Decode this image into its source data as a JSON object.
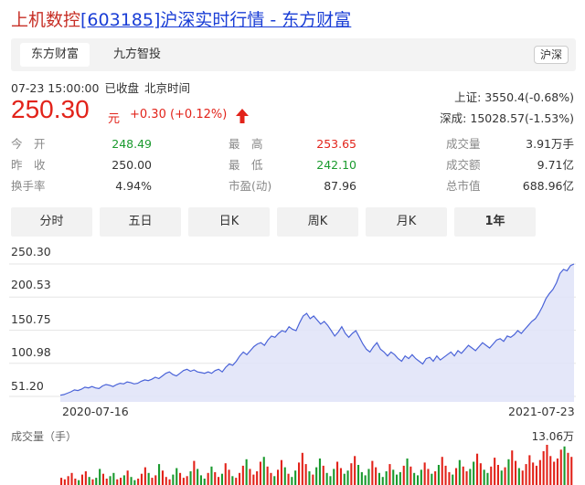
{
  "header": {
    "name": "上机数控",
    "code": "[603185]",
    "suffix": "沪深实时行情 - 东方财富"
  },
  "tabs": [
    {
      "label": "东方财富",
      "active": true
    },
    {
      "label": "九方智投",
      "active": false
    }
  ],
  "market_pill": "沪深",
  "status": {
    "datetime": "07-23 15:00:00",
    "state": "已收盘",
    "timezone": "北京时间"
  },
  "quote": {
    "price": "250.30",
    "unit": "元",
    "change": "+0.30 (+0.12%)",
    "direction": "up"
  },
  "indices": [
    {
      "label": "上证:",
      "value": "3550.4(-0.68%)"
    },
    {
      "label": "深成:",
      "value": "15028.57(-1.53%)"
    }
  ],
  "stats": [
    [
      {
        "label": "今　开",
        "value": "248.49",
        "color": "green"
      },
      {
        "label": "最　高",
        "value": "253.65",
        "color": "red"
      },
      {
        "label": "成交量",
        "value": "3.91万手",
        "color": ""
      }
    ],
    [
      {
        "label": "昨　收",
        "value": "250.00",
        "color": ""
      },
      {
        "label": "最　低",
        "value": "242.10",
        "color": "green"
      },
      {
        "label": "成交额",
        "value": "9.71亿",
        "color": ""
      }
    ],
    [
      {
        "label": "换手率",
        "value": "4.94%",
        "color": ""
      },
      {
        "label": "市盈(动)",
        "value": "87.96",
        "color": ""
      },
      {
        "label": "总市值",
        "value": "688.96亿",
        "color": ""
      }
    ]
  ],
  "period_tabs": [
    {
      "label": "分时",
      "active": false
    },
    {
      "label": "五日",
      "active": false
    },
    {
      "label": "日K",
      "active": false
    },
    {
      "label": "周K",
      "active": false
    },
    {
      "label": "月K",
      "active": false
    },
    {
      "label": "1年",
      "active": true
    }
  ],
  "volume": {
    "label": "成交量（手）",
    "max_label": "13.06万"
  },
  "chart_data": {
    "type": "area",
    "y_ticks": [
      "250.30",
      "200.53",
      "150.75",
      "100.98",
      "51.20"
    ],
    "ylim": [
      51.2,
      250.3
    ],
    "x_labels": [
      "2020-07-16",
      "2021-07-23"
    ],
    "values": [
      53,
      54,
      56,
      58,
      61,
      60,
      62,
      65,
      64,
      66,
      64,
      63,
      67,
      69,
      68,
      66,
      69,
      71,
      70,
      73,
      72,
      70,
      71,
      74,
      76,
      75,
      77,
      80,
      78,
      82,
      86,
      88,
      84,
      82,
      86,
      90,
      92,
      89,
      91,
      88,
      87,
      86,
      88,
      86,
      90,
      92,
      88,
      95,
      100,
      98,
      104,
      112,
      118,
      114,
      120,
      126,
      130,
      132,
      128,
      136,
      142,
      140,
      146,
      150,
      148,
      156,
      152,
      150,
      162,
      172,
      176,
      168,
      172,
      166,
      160,
      164,
      158,
      150,
      142,
      148,
      156,
      146,
      140,
      146,
      150,
      140,
      130,
      122,
      118,
      126,
      132,
      122,
      118,
      112,
      118,
      114,
      108,
      104,
      112,
      108,
      114,
      108,
      104,
      100,
      108,
      110,
      104,
      112,
      106,
      110,
      114,
      118,
      112,
      120,
      116,
      122,
      128,
      124,
      120,
      126,
      132,
      128,
      124,
      130,
      136,
      138,
      134,
      142,
      140,
      144,
      150,
      146,
      152,
      158,
      164,
      168,
      176,
      186,
      198,
      206,
      212,
      222,
      236,
      242,
      240,
      248,
      250.3
    ],
    "grid": true,
    "color": "#4a63d8",
    "fill": "#dfe3f8"
  },
  "volume_data": {
    "max": 130600,
    "values": [
      18,
      14,
      22,
      30,
      16,
      12,
      26,
      34,
      20,
      14,
      18,
      40,
      28,
      16,
      22,
      30,
      14,
      18,
      24,
      36,
      20,
      12,
      16,
      28,
      44,
      30,
      18,
      24,
      52,
      36,
      20,
      14,
      26,
      42,
      30,
      18,
      22,
      34,
      60,
      40,
      24,
      16,
      30,
      46,
      32,
      20,
      28,
      54,
      38,
      22,
      18,
      30,
      48,
      64,
      40,
      26,
      34,
      58,
      70,
      46,
      30,
      22,
      38,
      62,
      44,
      28,
      20,
      36,
      56,
      80,
      52,
      34,
      26,
      44,
      66,
      48,
      30,
      22,
      40,
      58,
      42,
      28,
      36,
      54,
      72,
      50,
      32,
      24,
      40,
      60,
      44,
      30,
      20,
      34,
      52,
      38,
      26,
      32,
      48,
      66,
      46,
      30,
      24,
      38,
      56,
      40,
      28,
      34,
      50,
      70,
      48,
      32,
      26,
      42,
      62,
      46,
      34,
      40,
      58,
      78,
      54,
      38,
      30,
      46,
      68,
      50,
      36,
      44,
      64,
      86,
      60,
      42,
      36,
      52,
      74,
      56,
      48,
      62,
      84,
      100,
      72,
      58,
      66,
      88,
      96,
      80,
      70
    ],
    "up_color": "#e2231a",
    "down_color": "#1a9a2e"
  }
}
